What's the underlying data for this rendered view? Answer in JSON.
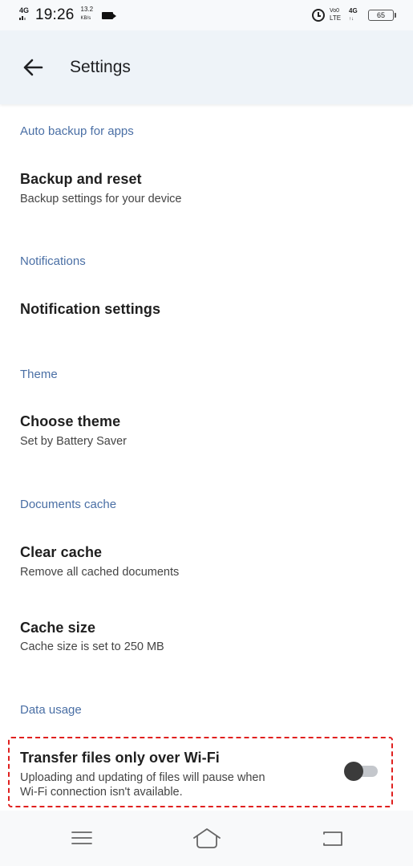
{
  "status_bar": {
    "network_label": "4G",
    "time": "19:26",
    "speed_value": "13.2",
    "speed_unit": "KB/s",
    "volte_top": "Vo0",
    "volte_bottom": "LTE",
    "data_top": "4G",
    "data_bottom": "↑↓",
    "battery_level": "65",
    "icons": [
      "signal-icon",
      "video-record-icon",
      "alarm-icon",
      "volte-icon",
      "mobile-data-icon",
      "battery-icon"
    ]
  },
  "app_bar": {
    "back_icon": "arrow-back-icon",
    "title": "Settings"
  },
  "sections": [
    {
      "header": "Auto backup for apps",
      "items": [
        {
          "title": "Backup and reset",
          "subtitle": "Backup settings for your device"
        }
      ]
    },
    {
      "header": "Notifications",
      "items": [
        {
          "title": "Notification settings"
        }
      ]
    },
    {
      "header": "Theme",
      "items": [
        {
          "title": "Choose theme",
          "subtitle": "Set by Battery Saver"
        }
      ]
    },
    {
      "header": "Documents cache",
      "items": [
        {
          "title": "Clear cache",
          "subtitle": "Remove all cached documents"
        },
        {
          "title": "Cache size",
          "subtitle": "Cache size is set to 250 MB"
        }
      ]
    },
    {
      "header": "Data usage",
      "items": [
        {
          "title": "Transfer files only over Wi-Fi",
          "subtitle_line1": "Uploading and updating of files will pause when",
          "subtitle_line2": "Wi-Fi connection isn't available.",
          "toggle_on": false
        }
      ]
    }
  ],
  "highlight_color": "#e0201f",
  "accent_color": "#4a6fa5",
  "nav_bar": {
    "icons": [
      "menu-icon",
      "home-icon",
      "back-icon"
    ]
  }
}
